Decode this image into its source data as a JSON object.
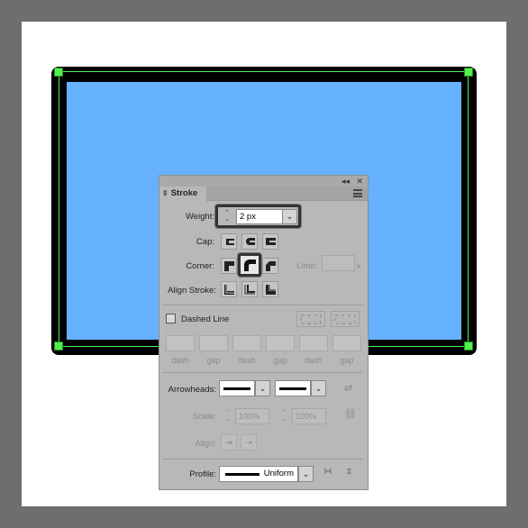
{
  "canvas": {
    "colors": {
      "background": "#6e6e6e",
      "artboard": "#ffffff",
      "stroke": "#000000",
      "fill": "#66b2ff",
      "selection": "#4ef24e"
    }
  },
  "panel": {
    "close_glyph": "✕",
    "collapse_glyph": "◂◂",
    "tab_label": "Stroke",
    "weight": {
      "label": "Weight:",
      "value": "2 px"
    },
    "cap": {
      "label": "Cap:"
    },
    "corner": {
      "label": "Corner:",
      "limit_label": "Limit:",
      "limit_suffix": "x"
    },
    "align_stroke": {
      "label": "Align Stroke:"
    },
    "dashed_line": {
      "label": "Dashed Line",
      "checked": false
    },
    "dash_gap_labels": [
      "dash",
      "gap",
      "dash",
      "gap",
      "dash",
      "gap"
    ],
    "arrowheads": {
      "label": "Arrowheads:"
    },
    "scale": {
      "label": "Scale:",
      "start": "100%",
      "end": "100%"
    },
    "align": {
      "label": "Align:"
    },
    "profile": {
      "label": "Profile:",
      "value": "Uniform"
    }
  }
}
